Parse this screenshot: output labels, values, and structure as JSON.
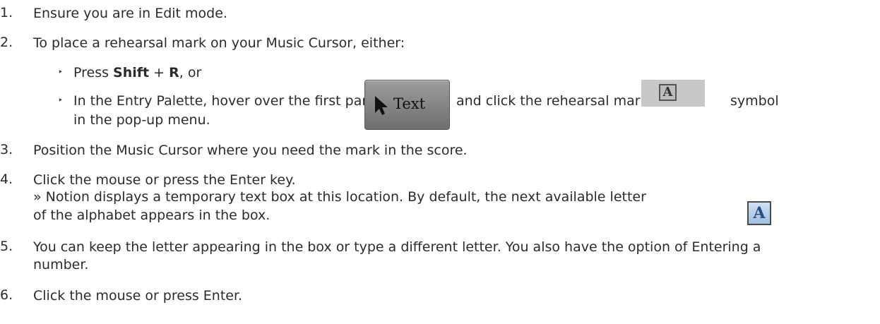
{
  "steps": [
    {
      "num": "1.",
      "text": "Ensure you are in Edit mode."
    },
    {
      "num": "2.",
      "text": "To place a rehearsal mark on your Music Cursor, either:"
    },
    {
      "num": "3.",
      "text": "Position the Music Cursor where you need the mark in the score."
    },
    {
      "num": "4.",
      "text": "Click the mouse or press the Enter key."
    },
    {
      "num": "5.",
      "text": "You can keep the letter appearing in the box or type a different letter. You also have the option of Entering a",
      "text2": "number."
    },
    {
      "num": "6.",
      "text": "Click the mouse or press Enter."
    }
  ],
  "sub": {
    "press_prefix": "Press ",
    "shift": "Shift",
    "plus": " + ",
    "r": "R",
    "press_suffix": ", or",
    "palette_a": "In the Entry Palette, hover over the first pane",
    "palette_b": "and click the rehearsal mark",
    "palette_c": "symbol",
    "palette_d": "in the pop-up menu."
  },
  "result": {
    "line1": "» Notion displays a temporary text box at this location. By default, the next available letter",
    "line2": "of the alphabet appears in the box."
  },
  "text_pane_label": "Text",
  "rehearsal_letter": "A",
  "a_icon_letter": "A"
}
